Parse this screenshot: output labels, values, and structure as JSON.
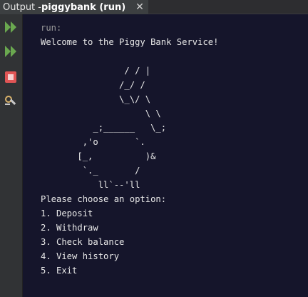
{
  "tab": {
    "prefix": "Output - ",
    "title": "piggybank (run)",
    "close": "✕"
  },
  "toolbar": {
    "buttons": [
      {
        "name": "rerun-icon",
        "color": "#6aa84f"
      },
      {
        "name": "rerun-with-params-icon",
        "color": "#6aa84f"
      },
      {
        "name": "stop-icon",
        "color": "#e05555"
      },
      {
        "name": "settings-icon",
        "color": "#c8c8c8"
      }
    ]
  },
  "output": {
    "lines": [
      "run:",
      "Welcome to the Piggy Bank Service!",
      "",
      "                / / |",
      "               /_/ /",
      "               \\_\\/ \\",
      "                    \\ \\",
      "          _;______   \\_;",
      "        ,'o       `.",
      "       [_,          )&",
      "        `._       /",
      "           ll`--'ll",
      "Please choose an option:",
      "1. Deposit",
      "2. Withdraw",
      "3. Check balance",
      "4. View history",
      "5. Exit"
    ]
  }
}
